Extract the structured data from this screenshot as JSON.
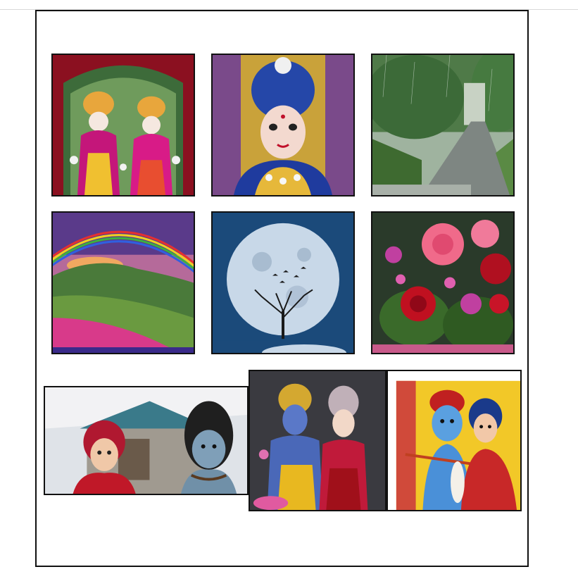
{
  "document": {
    "photos": [
      {
        "name": "photo-radha-krishna-idols",
        "subject": "radha-krishna-idols"
      },
      {
        "name": "photo-krishna-idol-blue-turban",
        "subject": "krishna-idol"
      },
      {
        "name": "photo-rainy-forest-road",
        "subject": "rainy-road"
      },
      {
        "name": "photo-double-rainbow-meadow",
        "subject": "double-rainbow"
      },
      {
        "name": "photo-full-moon-tree-birds",
        "subject": "full-moon"
      },
      {
        "name": "photo-rose-bouquet",
        "subject": "roses"
      },
      {
        "name": "photo-parvati-shiva-temple",
        "subject": "shiva-parvati"
      },
      {
        "name": "photo-vishnu-lakshmi-idols",
        "subject": "vishnu-lakshmi"
      },
      {
        "name": "photo-radha-krishna-painting",
        "subject": "radha-krishna-painting"
      }
    ]
  },
  "colors": {
    "frame_border": "#111111",
    "ruler_line": "#d9d9d9",
    "page_background": "#ffffff"
  }
}
